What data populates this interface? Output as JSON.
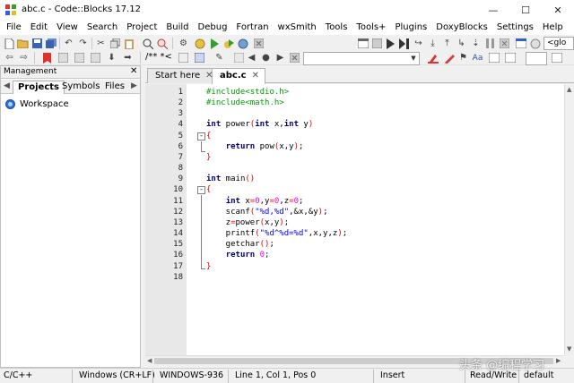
{
  "window": {
    "title": "abc.c - Code::Blocks 17.12",
    "minimize": "—",
    "maximize": "☐",
    "close": "✕"
  },
  "menu": [
    "File",
    "Edit",
    "View",
    "Search",
    "Project",
    "Build",
    "Debug",
    "Fortran",
    "wxSmith",
    "Tools",
    "Tools+",
    "Plugins",
    "DoxyBlocks",
    "Settings",
    "Help"
  ],
  "toolbar": {
    "target_combo": "<glo",
    "doc_comment": "/** *<"
  },
  "management": {
    "title": "Management",
    "close": "✕",
    "tab_prev": "◀",
    "tab_next": "▶",
    "tabs": [
      "Projects",
      "Symbols",
      "Files"
    ],
    "workspace": "Workspace"
  },
  "editor": {
    "tabs": [
      {
        "label": "Start here",
        "close": "✕",
        "active": false
      },
      {
        "label": "abc.c",
        "close": "✕",
        "active": true
      }
    ],
    "line_numbers": [
      "1",
      "2",
      "3",
      "4",
      "5",
      "6",
      "7",
      "8",
      "9",
      "10",
      "11",
      "12",
      "13",
      "14",
      "15",
      "16",
      "17",
      "18"
    ]
  },
  "status": {
    "language": "C/C++",
    "line_endings": "Windows (CR+LF)",
    "encoding": "WINDOWS-936",
    "position": "Line 1, Col 1, Pos 0",
    "mode": "Insert",
    "access": "Read/Write",
    "profile": "default"
  },
  "watermark": "头条 @编程学习"
}
